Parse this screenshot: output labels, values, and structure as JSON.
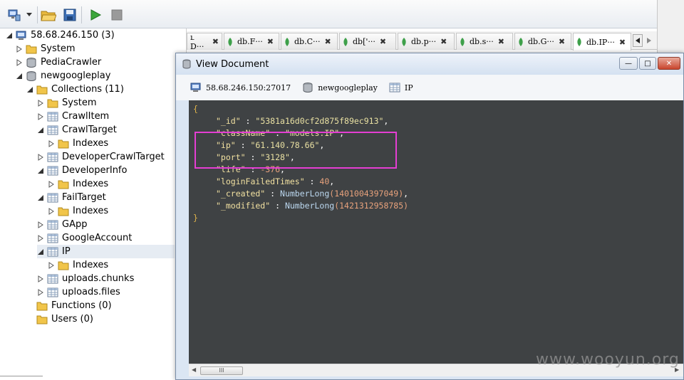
{
  "toolbar": {
    "icons": [
      "connect-icon",
      "dropdown-arrow-icon",
      "open-folder-icon",
      "save-icon",
      "run-icon",
      "stop-icon"
    ]
  },
  "tree": {
    "server": "58.68.246.150 (3)",
    "system": "System",
    "pedia": "PediaCrawler",
    "db": "newgoogleplay",
    "collections": "Collections (11)",
    "c_system": "System",
    "crawl_item": "CrawlItem",
    "crawl_target": "CrawlTarget",
    "indexes": "Indexes",
    "dev_crawl_target": "DeveloperCrawlTarget",
    "dev_info": "DeveloperInfo",
    "fail_target": "FailTarget",
    "gapp": "GApp",
    "google_account": "GoogleAccount",
    "ip": "IP",
    "uploads_chunks": "uploads.chunks",
    "uploads_files": "uploads.files",
    "functions": "Functions (0)",
    "users": "Users (0)"
  },
  "tabs": {
    "t0": "ւ D···",
    "t1": "db.F···",
    "t2": "db.C···",
    "t3": "db['···",
    "t4": "db.p···",
    "t5": "db.s···",
    "t6": "db.G···",
    "t7": "db.IP···",
    "close": "✖"
  },
  "dialog": {
    "title": "View Document",
    "server": "58.68.246.150:27017",
    "database": "newgoogleplay",
    "collection": "IP",
    "min_label": "—",
    "max_label": "□",
    "close_label": "✕"
  },
  "document": {
    "open": "{",
    "close": "}",
    "id_key": "\"_id\"",
    "id_val": "\"5381a16d0cf2d875f89ec913\"",
    "class_key": "\"className\"",
    "class_val": "\"models.IP\"",
    "ip_key": "\"ip\"",
    "ip_val": "\"61.140.78.66\"",
    "port_key": "\"port\"",
    "port_val": "\"3128\"",
    "life_key": "\"life\"",
    "life_val": "-376",
    "lft_key": "\"loginFailedTimes\"",
    "lft_val": "40",
    "created_key": "\"_created\"",
    "created_fn": "NumberLong",
    "created_val": "(1401004397049)",
    "modified_key": "\"_modified\"",
    "modified_fn": "NumberLong",
    "modified_val": "(1421312958785)",
    "colon": " : ",
    "comma": ","
  },
  "scroll": {
    "thumb_label": "III"
  },
  "watermark": "www.wooyun.org",
  "colors": {
    "highlight": "#e53ed3",
    "editor_bg": "#3f4244",
    "mongo_leaf": "#3ea04a"
  }
}
